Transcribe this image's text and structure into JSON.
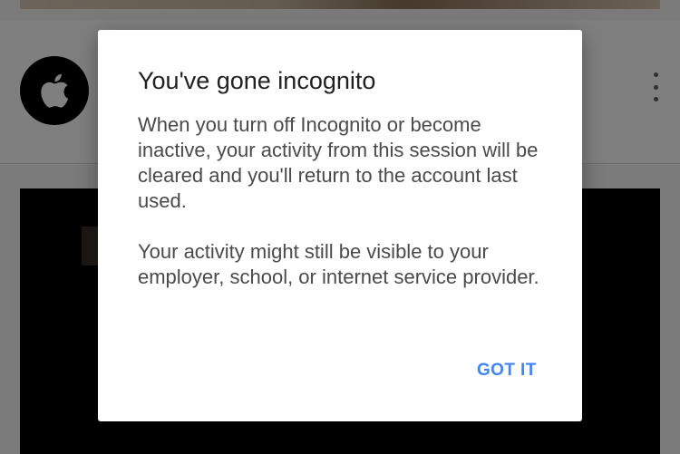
{
  "background": {
    "channel_avatar_icon": "apple-logo-icon",
    "menu_icon": "more-vert-icon"
  },
  "dialog": {
    "title": "You've gone incognito",
    "paragraph_1": "When you turn off Incognito or become inactive, your activity from this session will be cleared and you'll return to the account last used.",
    "paragraph_2": "Your activity might still be visible to your employer, school, or internet service provider.",
    "action_label": "GOT IT"
  },
  "colors": {
    "accent": "#4285f4",
    "dialog_background": "#ffffff",
    "title_text": "#212121",
    "body_text": "#4a4a4a"
  }
}
